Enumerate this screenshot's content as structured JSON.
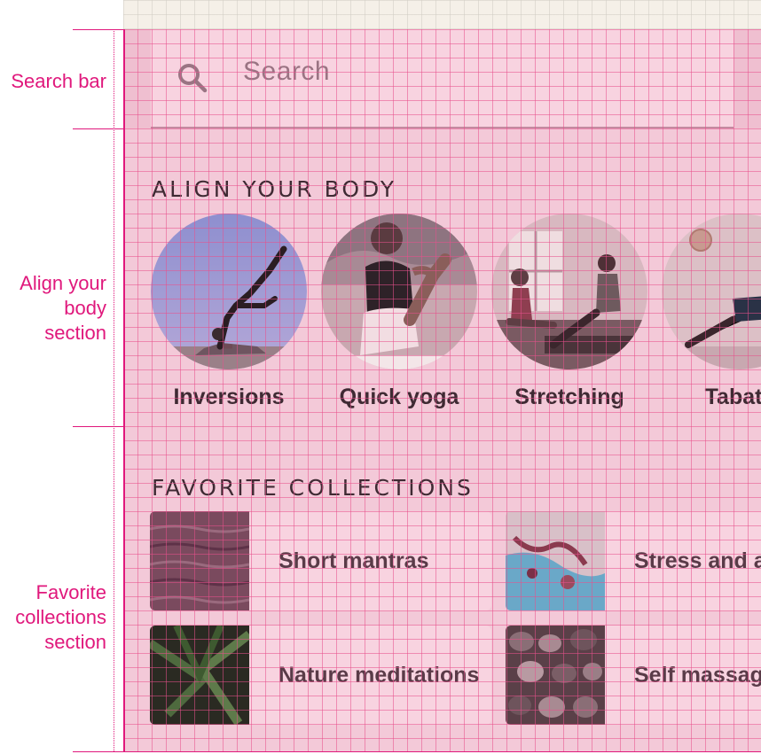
{
  "annotations": {
    "search_bar": "Search bar",
    "align_section": "Align your body section",
    "favorites_section": "Favorite collections section"
  },
  "search": {
    "placeholder": "Search",
    "icon": "search-icon"
  },
  "align_body": {
    "title": "ALIGN YOUR BODY",
    "items": [
      {
        "label": "Inversions"
      },
      {
        "label": "Quick yoga"
      },
      {
        "label": "Stretching"
      },
      {
        "label": "Tabata"
      }
    ]
  },
  "favorites": {
    "title": "FAVORITE COLLECTIONS",
    "items": [
      {
        "label": "Short mantras"
      },
      {
        "label": "Stress and anxiety"
      },
      {
        "label": "Nature meditations"
      },
      {
        "label": "Self massage"
      }
    ]
  },
  "colors": {
    "annotation": "#e0187c",
    "background": "#f3c9d8",
    "card": "#f8d3e0",
    "text": "#3f2a33"
  }
}
